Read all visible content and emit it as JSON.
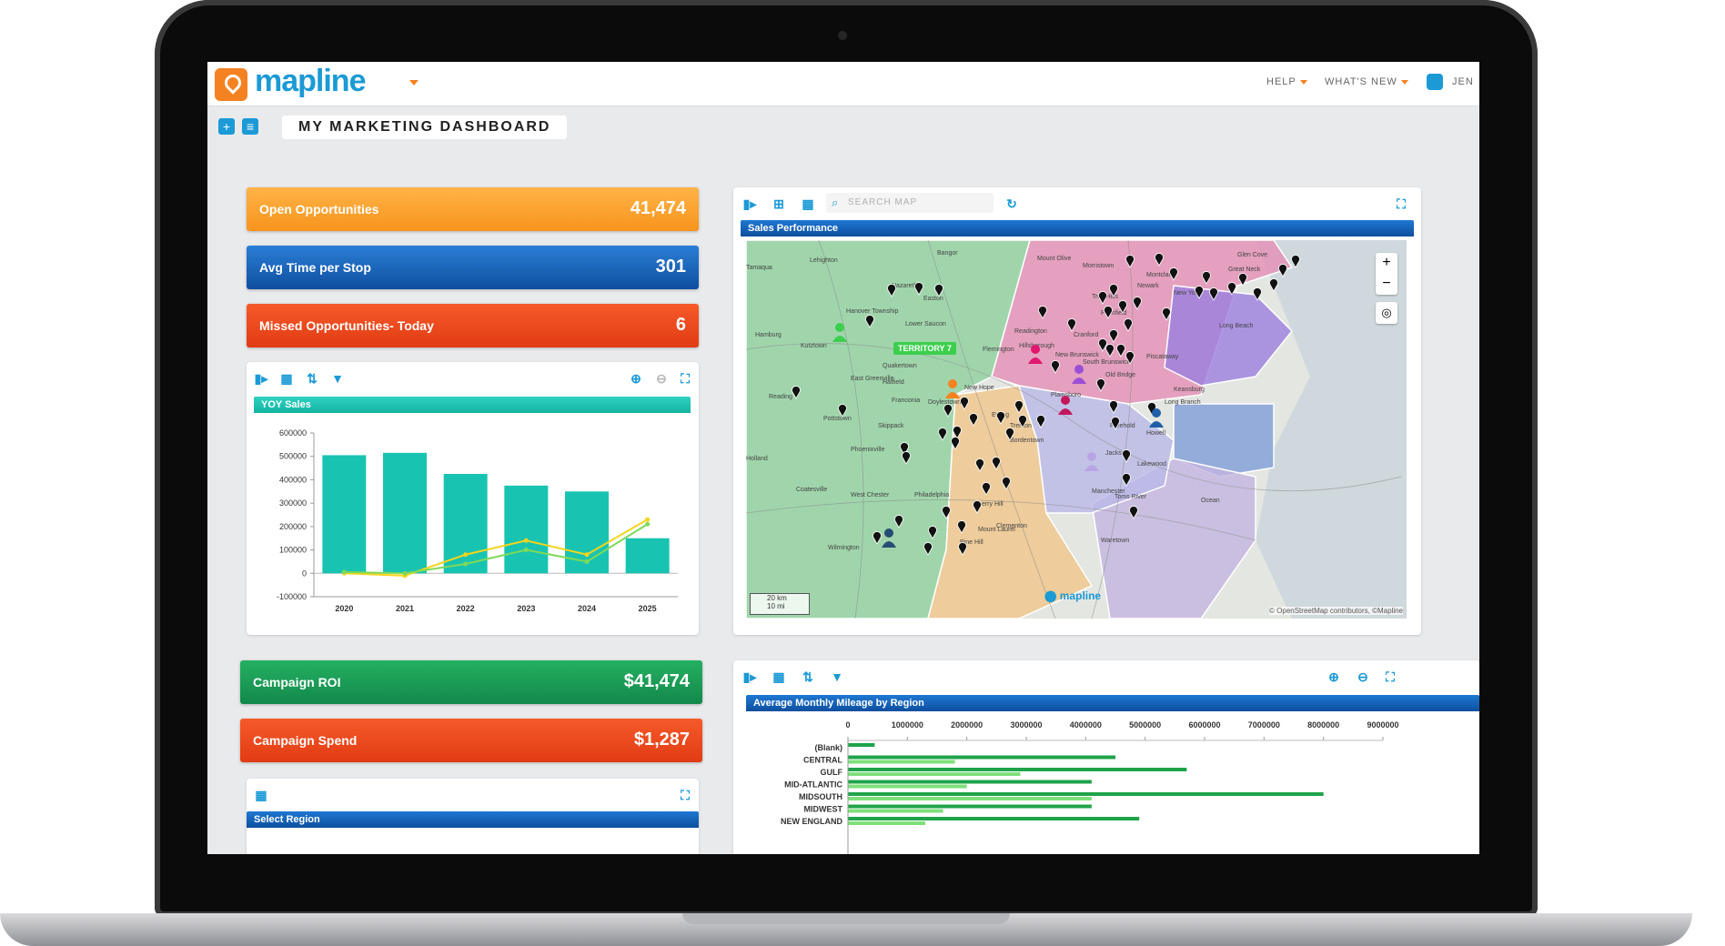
{
  "header": {
    "logo_text": "mapline",
    "help_label": "HELP",
    "whats_new_label": "WHAT'S NEW",
    "user_label": "JEN"
  },
  "dashboard": {
    "title": "MY MARKETING DASHBOARD"
  },
  "metrics": [
    {
      "label": "Open Opportunities",
      "value": "41,474",
      "color": "#f7941d"
    },
    {
      "label": "Avg Time per Stop",
      "value": "301",
      "color": "#0f4ea0"
    },
    {
      "label": "Missed Opportunities- Today",
      "value": "6",
      "color": "#e13b13"
    },
    {
      "label": "Campaign ROI",
      "value": "$41,474",
      "color": "#12894a"
    },
    {
      "label": "Campaign Spend",
      "value": "$1,287",
      "color": "#e13b13"
    }
  ],
  "map_panel": {
    "search_placeholder": "SEARCH MAP",
    "title": "Sales Performance",
    "territory_label": "TERRITORY 7",
    "scale_km": "20 km",
    "scale_mi": "10 mi",
    "attribution": "© OpenStreetMap contributors, ©Mapline",
    "place_labels": [
      "Bangor",
      "Mount Olive",
      "Lehighton",
      "Nazareth",
      "Easton",
      "Hanover Township",
      "Lower Saucon",
      "Hamburg",
      "Kutztown",
      "Quakertown",
      "East Greenville",
      "Reading",
      "Pottstown",
      "Skippack",
      "Phoenixville",
      "Doylestown",
      "New Hope",
      "Flemington",
      "Hillsborough",
      "Readington",
      "Plainfield",
      "Newark",
      "New York",
      "Long Beach",
      "Great Neck",
      "Glen Cove",
      "New Brunswick",
      "South Brunswick",
      "Old Bridge",
      "Plainsboro",
      "Ewing",
      "Trenton",
      "Bordentown",
      "Freehold",
      "Long Branch",
      "Jackson",
      "Lakewood",
      "Manchester",
      "Toms River",
      "Waretown",
      "Philadelphia",
      "Cherry Hill",
      "Mount Laurel",
      "West Chester",
      "Coatesville",
      "Wilmington",
      "Pine Hill",
      "Clementon",
      "Hatfield",
      "Franconia",
      "Holland",
      "Tamaqua",
      "Morristown",
      "Montclair",
      "Troy Hills",
      "Cranford",
      "Piscataway",
      "Keansburg",
      "Howell",
      "Ocean"
    ],
    "territory_colors": [
      "#8fd19e",
      "#e48fb5",
      "#9b7fe0",
      "#f0c58a",
      "#7f9ed8",
      "#c3b5e0",
      "#b9b9e8"
    ],
    "marker_icon": "map-pin-icon"
  },
  "yoy_chart": {
    "title": "YOY Sales",
    "chart_data": {
      "type": "bar",
      "title": "YOY Sales",
      "categories": [
        "2020",
        "2021",
        "2022",
        "2023",
        "2024",
        "2025"
      ],
      "yticks": [
        -100000,
        0,
        100000,
        200000,
        300000,
        400000,
        500000,
        600000
      ],
      "ylim": [
        -100000,
        600000
      ],
      "series": [
        {
          "type": "bar",
          "values": [
            505000,
            515000,
            425000,
            375000,
            350000,
            150000
          ],
          "color": "#18c4b1"
        },
        {
          "type": "line",
          "values": [
            0,
            -10000,
            80000,
            140000,
            80000,
            230000
          ],
          "color": "#f5d41b"
        },
        {
          "type": "line",
          "values": [
            5000,
            0,
            40000,
            100000,
            50000,
            210000
          ],
          "color": "#7ed957"
        }
      ]
    }
  },
  "mileage_chart": {
    "title": "Average Monthly Mileage by Region",
    "chart_data": {
      "type": "bar",
      "orientation": "horizontal",
      "title": "Average Monthly Mileage by Region",
      "categories": [
        "(Blank)",
        "CENTRAL",
        "GULF",
        "MID-ATLANTIC",
        "MIDSOUTH",
        "MIDWEST",
        "NEW ENGLAND"
      ],
      "xticks": [
        0,
        1000000,
        2000000,
        3000000,
        4000000,
        5000000,
        6000000,
        7000000,
        8000000,
        9000000
      ],
      "xlim": [
        0,
        9000000
      ],
      "series": [
        {
          "values": [
            450000,
            4500000,
            5700000,
            4100000,
            8000000,
            4100000,
            4900000
          ],
          "color": "#1fa34a"
        },
        {
          "values": [
            0,
            1800000,
            2900000,
            2000000,
            4100000,
            1600000,
            1300000
          ],
          "color": "#7ee07a"
        }
      ]
    }
  },
  "select_region": {
    "title": "Select Region"
  }
}
